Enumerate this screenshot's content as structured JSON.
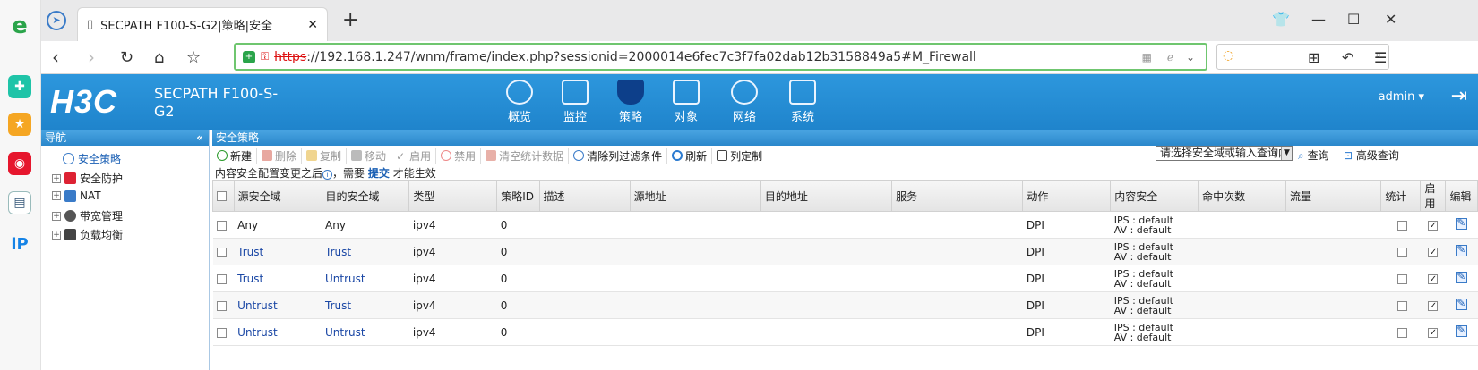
{
  "browser": {
    "tab_title": "SECPATH F100-S-G2|策略|安全",
    "url_https": "https",
    "url_rest": "://192.168.1.247/wnm/frame/index.php?sessionid=2000014e6fec7c3f7fa02dab12b3158849a5#M_Firewall",
    "new_tab": "+"
  },
  "app": {
    "logo": "H3C",
    "product": "SECPATH F100-S-G2",
    "menu": [
      {
        "label": "概览",
        "icon": "gauge-icon"
      },
      {
        "label": "监控",
        "icon": "monitor-icon"
      },
      {
        "label": "策略",
        "icon": "shield-icon"
      },
      {
        "label": "对象",
        "icon": "server-icon"
      },
      {
        "label": "网络",
        "icon": "internet-icon"
      },
      {
        "label": "系统",
        "icon": "code-icon"
      }
    ],
    "user": "admin"
  },
  "nav": {
    "header": "导航",
    "collapse": "«",
    "items": [
      "安全策略",
      "安全防护",
      "NAT",
      "带宽管理",
      "负载均衡"
    ]
  },
  "content": {
    "header": "安全策略",
    "toolbar": {
      "new": "新建",
      "delete": "删除",
      "copy": "复制",
      "move": "移动",
      "enable": "启用",
      "disable": "禁用",
      "clear_stats": "清空统计数据",
      "clear_filters": "清除列过滤条件",
      "refresh": "刷新",
      "columns": "列定制",
      "filter_placeholder": "请选择安全域或输入查询内容",
      "query": "查询",
      "advanced_query": "高级查询"
    },
    "notice_prefix": "内容安全配置变更之后",
    "notice_mid": "，需要",
    "notice_link": "提交",
    "notice_suffix": "才能生效",
    "columns": [
      "源安全域",
      "目的安全域",
      "类型",
      "策略ID",
      "描述",
      "源地址",
      "目的地址",
      "服务",
      "动作",
      "内容安全",
      "命中次数",
      "流量",
      "统计",
      "启用",
      "编辑"
    ],
    "rows": [
      {
        "src": "Any",
        "dst": "Any",
        "type": "ipv4",
        "id": "0",
        "action": "DPI",
        "ips": "IPS : default",
        "av": "AV : default",
        "enabled": true
      },
      {
        "src": "Trust",
        "dst": "Trust",
        "type": "ipv4",
        "id": "0",
        "action": "DPI",
        "ips": "IPS : default",
        "av": "AV : default",
        "enabled": true
      },
      {
        "src": "Trust",
        "dst": "Untrust",
        "type": "ipv4",
        "id": "0",
        "action": "DPI",
        "ips": "IPS : default",
        "av": "AV : default",
        "enabled": true
      },
      {
        "src": "Untrust",
        "dst": "Trust",
        "type": "ipv4",
        "id": "0",
        "action": "DPI",
        "ips": "IPS : default",
        "av": "AV : default",
        "enabled": true
      },
      {
        "src": "Untrust",
        "dst": "Untrust",
        "type": "ipv4",
        "id": "0",
        "action": "DPI",
        "ips": "IPS : default",
        "av": "AV : default",
        "enabled": true
      }
    ]
  }
}
